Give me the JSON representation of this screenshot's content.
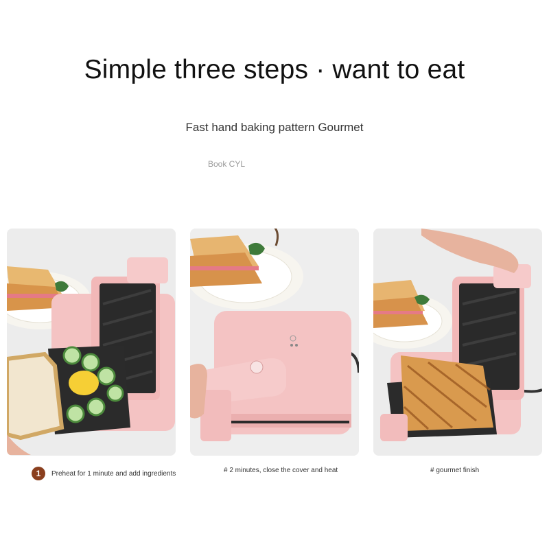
{
  "header": {
    "title": "Simple three steps · want to eat",
    "subtitle": "Fast hand baking pattern Gourmet",
    "note": "Book CYL"
  },
  "steps": [
    {
      "number": "1",
      "caption": "Preheat for 1 minute and add ingredients",
      "image": "open-sandwich-maker-with-ingredients"
    },
    {
      "number": "",
      "caption": "# 2 minutes, close the cover and heat",
      "image": "closed-sandwich-maker"
    },
    {
      "number": "",
      "caption": "# gourmet finish",
      "image": "toasted-sandwich-in-maker"
    }
  ],
  "colors": {
    "appliance_pink": "#f4c3c3",
    "plate_dark": "#2c2c2c",
    "toast": "#d99a4e",
    "badge": "#8a3f1e"
  }
}
